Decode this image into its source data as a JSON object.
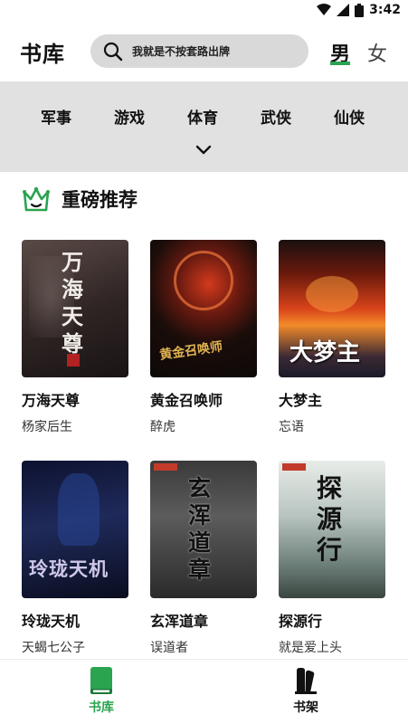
{
  "status_bar": {
    "time": "3:42",
    "icons": [
      "wifi-icon",
      "signal-icon",
      "battery-icon"
    ]
  },
  "header": {
    "title": "书库",
    "search_placeholder": "我就是不按套路出牌",
    "gender_tabs": [
      {
        "label": "男",
        "selected": true
      },
      {
        "label": "女",
        "selected": false
      }
    ]
  },
  "categories": [
    "军事",
    "游戏",
    "体育",
    "武侠",
    "仙侠"
  ],
  "section": {
    "title": "重磅推荐",
    "icon": "crown-icon"
  },
  "books": [
    {
      "title": "万海天尊",
      "author": "杨家后生",
      "cover_text": "万海天尊"
    },
    {
      "title": "黄金召唤师",
      "author": "醉虎",
      "cover_text": "黄金召唤师"
    },
    {
      "title": "大梦主",
      "author": "忘语",
      "cover_text": "大梦主"
    },
    {
      "title": "玲珑天机",
      "author": "天蝎七公子",
      "cover_text": "玲珑天机"
    },
    {
      "title": "玄浑道章",
      "author": "误道者",
      "cover_text": "玄浑道章"
    },
    {
      "title": "探源行",
      "author": "就是爱上头",
      "cover_text": "探源行"
    }
  ],
  "bottom_nav": [
    {
      "label": "书库",
      "icon": "book-icon",
      "active": true,
      "color": "#2aa44f"
    },
    {
      "label": "书架",
      "icon": "bookshelf-icon",
      "active": false,
      "color": "#111111"
    }
  ],
  "colors": {
    "accent": "#2aa44f",
    "category_bg": "#e1e1e1",
    "search_bg": "#d9d9d9"
  }
}
